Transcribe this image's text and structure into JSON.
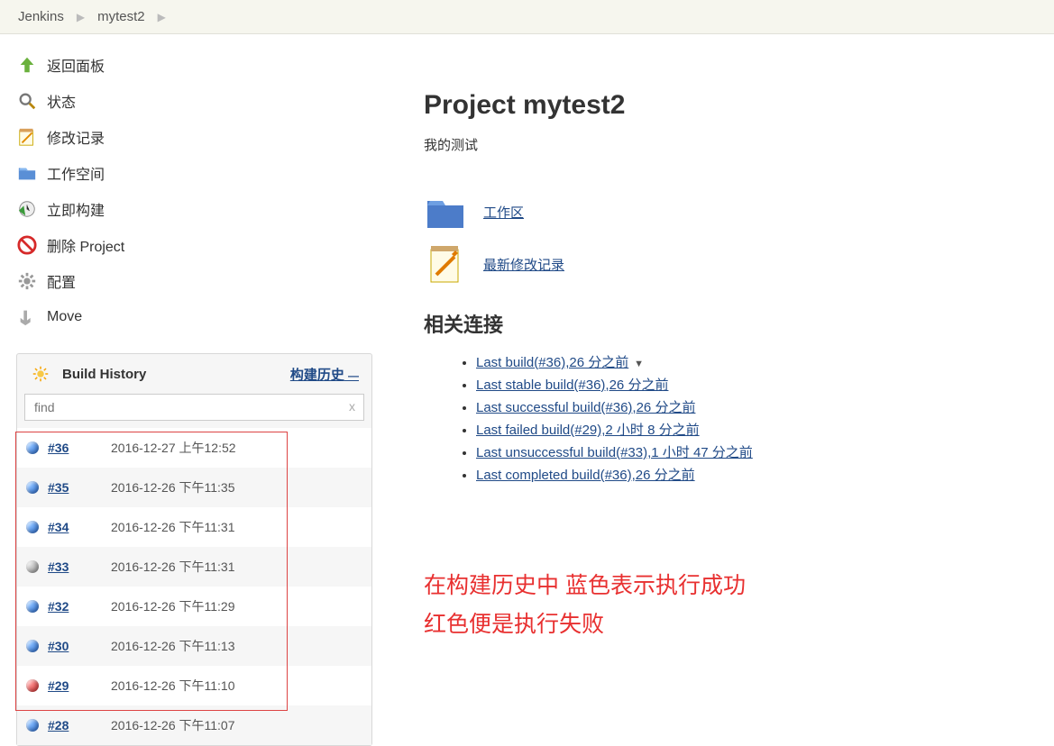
{
  "breadcrumb": {
    "root": "Jenkins",
    "job": "mytest2"
  },
  "sidebar": {
    "tasks": [
      {
        "label": "返回面板"
      },
      {
        "label": "状态"
      },
      {
        "label": "修改记录"
      },
      {
        "label": "工作空间"
      },
      {
        "label": "立即构建"
      },
      {
        "label": "删除 Project"
      },
      {
        "label": "配置"
      },
      {
        "label": "Move"
      }
    ],
    "buildHistory": {
      "title": "Build History",
      "trendLabel": "构建历史",
      "findPlaceholder": "find",
      "clearSymbol": "x",
      "builds": [
        {
          "num": "#36",
          "date": "2016-12-27 上午12:52",
          "status": "blue"
        },
        {
          "num": "#35",
          "date": "2016-12-26 下午11:35",
          "status": "blue"
        },
        {
          "num": "#34",
          "date": "2016-12-26 下午11:31",
          "status": "blue"
        },
        {
          "num": "#33",
          "date": "2016-12-26 下午11:31",
          "status": "grey"
        },
        {
          "num": "#32",
          "date": "2016-12-26 下午11:29",
          "status": "blue"
        },
        {
          "num": "#30",
          "date": "2016-12-26 下午11:13",
          "status": "blue"
        },
        {
          "num": "#29",
          "date": "2016-12-26 下午11:10",
          "status": "red"
        },
        {
          "num": "#28",
          "date": "2016-12-26 下午11:07",
          "status": "blue"
        }
      ]
    }
  },
  "main": {
    "title": "Project mytest2",
    "description": "我的测试",
    "workspaceLink": "工作区",
    "changesLink": "最新修改记录",
    "permalinksHeading": "相关连接",
    "permalinks": [
      {
        "text": "Last build(#36),26 分之前",
        "expand": true
      },
      {
        "text": "Last stable build(#36),26 分之前"
      },
      {
        "text": "Last successful build(#36),26 分之前"
      },
      {
        "text": "Last failed build(#29),2 小时 8 分之前"
      },
      {
        "text": "Last unsuccessful build(#33),1 小时 47 分之前"
      },
      {
        "text": "Last completed build(#36),26 分之前"
      }
    ],
    "annotation": "在构建历史中 蓝色表示执行成功\n红色便是执行失败"
  }
}
